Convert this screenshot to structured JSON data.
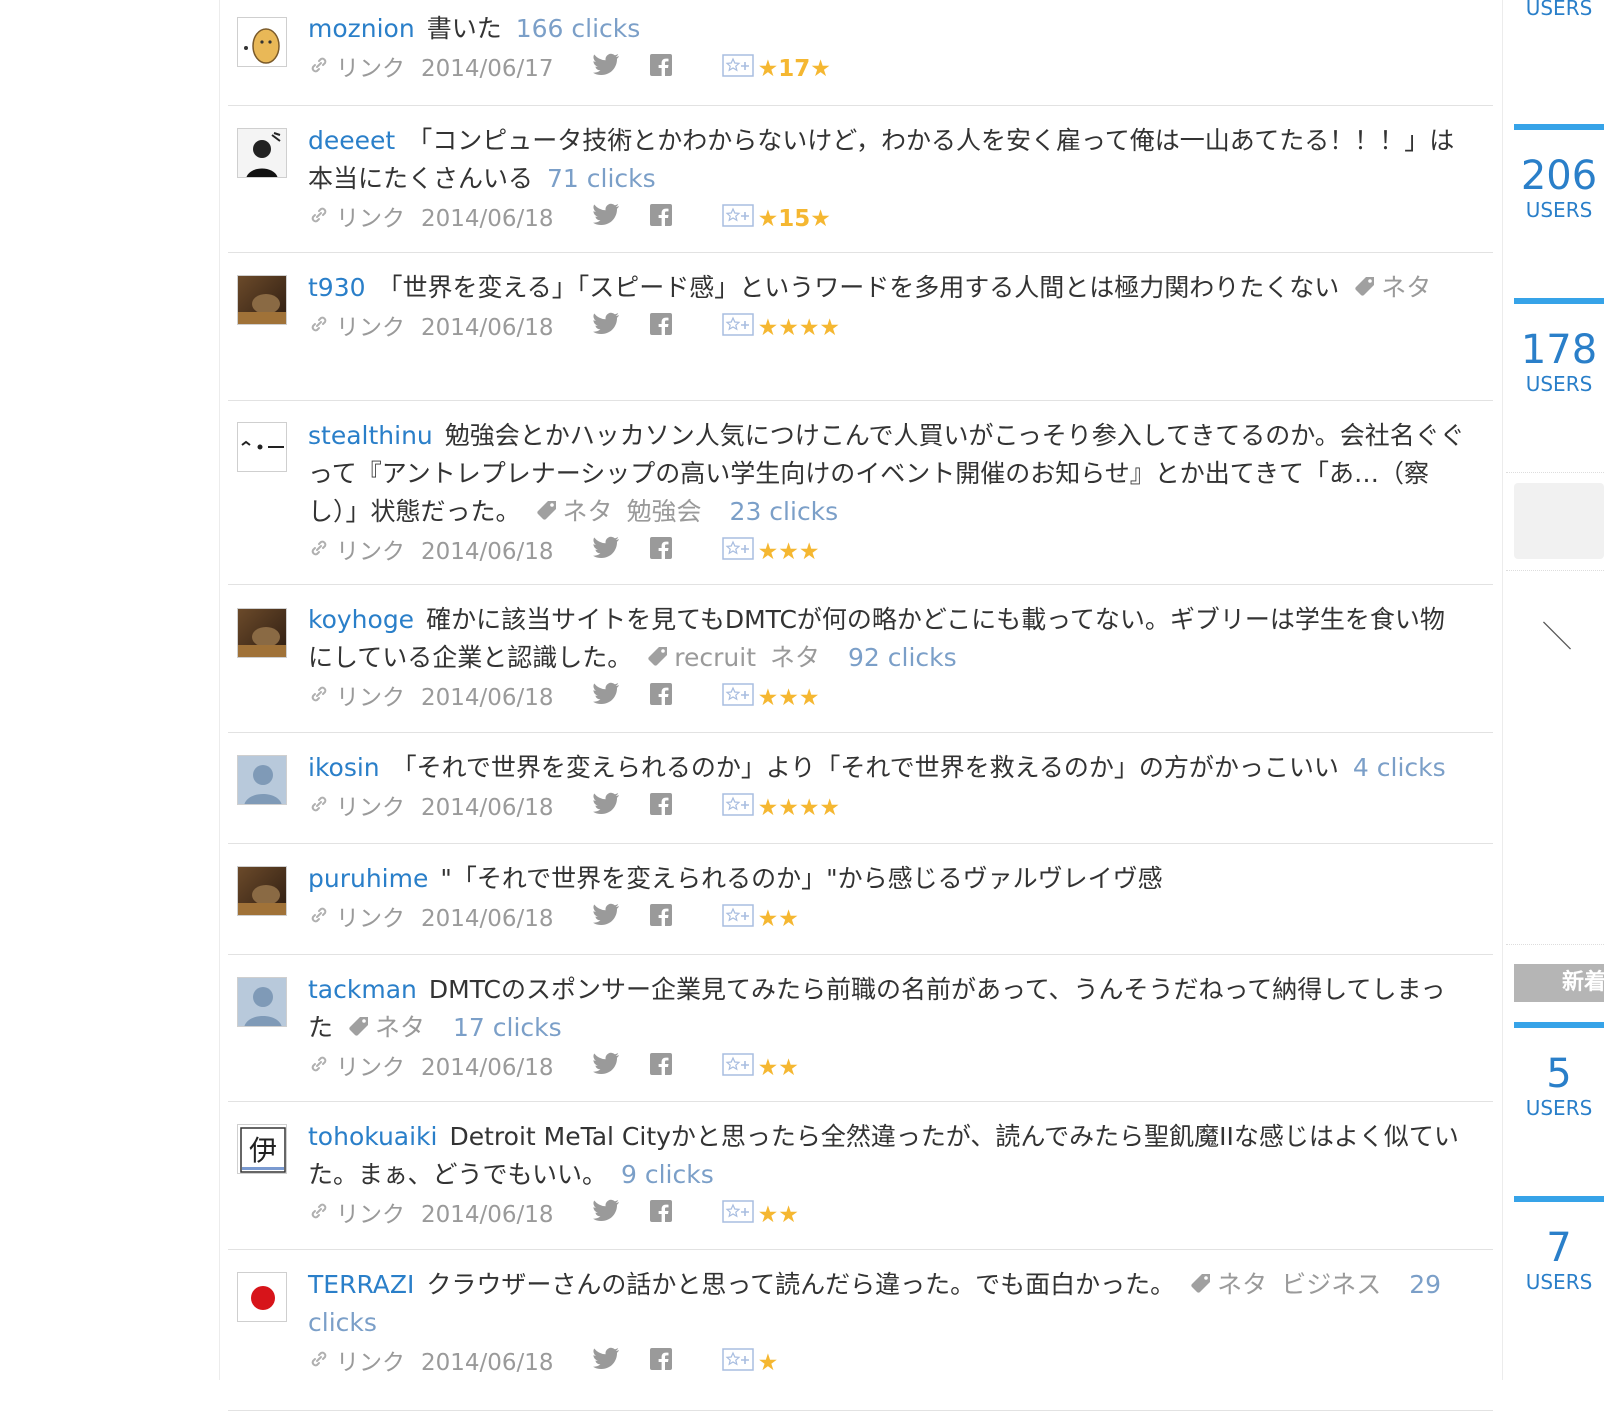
{
  "meta_labels": {
    "link": "リンク"
  },
  "comments": [
    {
      "user": "moznion",
      "text": "書いた",
      "tags": [],
      "clicks": "166 clicks",
      "date": "2014/06/17",
      "stars": "★17★",
      "avatar_icon": "character-icon"
    },
    {
      "user": "deeeet",
      "text": "「コンピュータ技術とかわからないけど，わかる人を安く雇って俺は一山あてたる！！！」は本当にたくさんいる",
      "tags": [],
      "clicks": "71 clicks",
      "date": "2014/06/18",
      "stars": "★15★",
      "avatar_icon": "person-photo"
    },
    {
      "user": "t930",
      "text": "「世界を変える」「スピード感」というワードを多用する人間とは極力関わりたくない",
      "tags": [
        "ネタ"
      ],
      "clicks": "",
      "date": "2014/06/18",
      "stars": "★★★★",
      "avatar_icon": "photo"
    },
    {
      "user": "stealthinu",
      "text": "勉強会とかハッカソン人気につけこんで人買いがこっそり参入してきてるのか。会社名ぐぐって『アントレプレナーシップの高い学生向けのイベント開催のお知らせ』とか出てきて「あ…（察し）」状態だった。",
      "tags": [
        "ネタ",
        "勉強会"
      ],
      "clicks": "23 clicks",
      "date": "2014/06/18",
      "stars": "★★★",
      "avatar_icon": "emoticon-icon"
    },
    {
      "user": "koyhoge",
      "text": "確かに該当サイトを見てもDMTCが何の略かどこにも載ってない。ギブリーは学生を食い物にしている企業と認識した。",
      "tags": [
        "recruit",
        "ネタ"
      ],
      "clicks": "92 clicks",
      "date": "2014/06/18",
      "stars": "★★★",
      "avatar_icon": "photo"
    },
    {
      "user": "ikosin",
      "text": "「それで世界を変えられるのか」より「それで世界を救えるのか」の方がかっこいい",
      "tags": [],
      "clicks": "4 clicks",
      "date": "2014/06/18",
      "stars": "★★★★",
      "avatar_icon": "default-user-icon"
    },
    {
      "user": "puruhime",
      "text": "\"「それで世界を変えられるのか」\"から感じるヴァルヴレイヴ感",
      "tags": [],
      "clicks": "",
      "date": "2014/06/18",
      "stars": "★★",
      "avatar_icon": "photo"
    },
    {
      "user": "tackman",
      "text": "DMTCのスポンサー企業見てみたら前職の名前があって、うんそうだねって納得してしまった",
      "tags": [
        "ネタ"
      ],
      "clicks": "17 clicks",
      "date": "2014/06/18",
      "stars": "★★",
      "avatar_icon": "default-user-icon"
    },
    {
      "user": "tohokuaiki",
      "text": "Detroit MeTal Cityかと思ったら全然違ったが、読んでみたら聖飢魔IIな感じはよく似ていた。まぁ、どうでもいい。",
      "tags": [],
      "clicks": "9 clicks",
      "date": "2014/06/18",
      "stars": "★★",
      "avatar_icon": "kanji-icon",
      "avatar_text": "伊"
    },
    {
      "user": "TERRAZI",
      "text": "クラウザーさんの話かと思って読んだら違った。でも面白かった。",
      "tags": [
        "ネタ",
        "ビジネス"
      ],
      "clicks": "29 clicks",
      "date": "2014/06/18",
      "stars": "★",
      "avatar_icon": "japan-flag-icon"
    }
  ],
  "sidebar": {
    "top_users": "USERS",
    "stats": [
      {
        "num": "206",
        "label": "USERS"
      },
      {
        "num": "178",
        "label": "USERS"
      },
      {
        "num": "5",
        "label": "USERS"
      },
      {
        "num": "7",
        "label": "USERS"
      }
    ],
    "new_label": "新着",
    "slash": "＼"
  },
  "colors": {
    "user": "#2a7fc9",
    "clicks": "#7b9fc8",
    "star": "#f5b731",
    "accent": "#36a3e8"
  }
}
